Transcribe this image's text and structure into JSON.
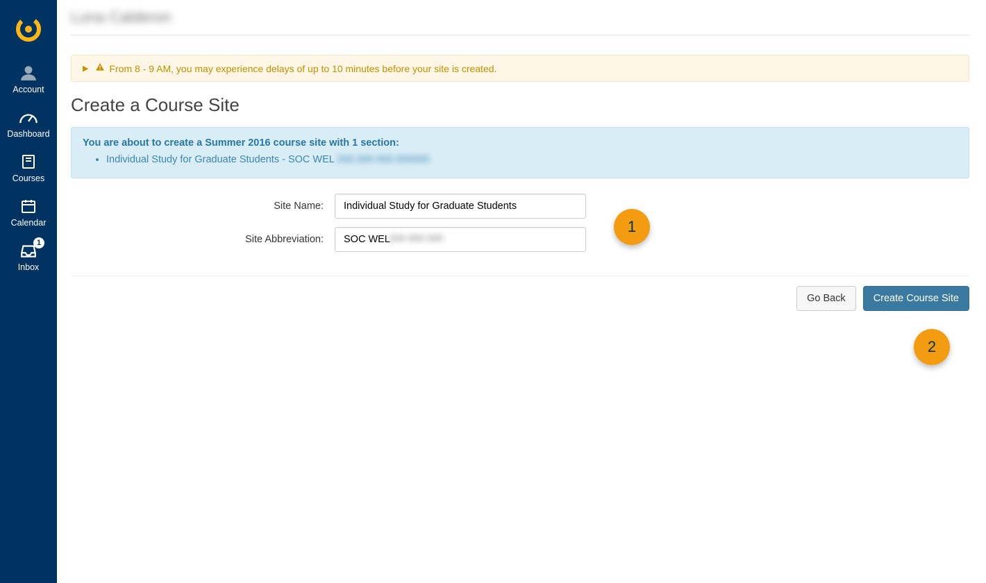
{
  "sidebar": {
    "items": [
      {
        "label": "Account"
      },
      {
        "label": "Dashboard"
      },
      {
        "label": "Courses"
      },
      {
        "label": "Calendar"
      },
      {
        "label": "Inbox",
        "badge": "1"
      }
    ]
  },
  "topbar": {
    "user_name_blurred": "Luna Calderon"
  },
  "alert": {
    "text": "From 8 - 9 AM, you may experience delays of up to 10 minutes before your site is created."
  },
  "page": {
    "title": "Create a Course Site"
  },
  "info": {
    "headline": "You are about to create a Summer 2016 course site with 1 section:",
    "item_prefix": "Individual Study for Graduate Students - SOC WEL",
    "item_redacted_tail": "200 000 000 000000"
  },
  "form": {
    "site_name_label": "Site Name:",
    "site_name_value": "Individual Study for Graduate Students",
    "site_abbrev_label": "Site Abbreviation:",
    "site_abbrev_value": "SOC WEL",
    "site_abbrev_redacted_tail": "200  000 000"
  },
  "markers": {
    "one": "1",
    "two": "2"
  },
  "actions": {
    "back": "Go Back",
    "create": "Create Course Site"
  },
  "colors": {
    "brand_navy": "#003262",
    "accent_orange": "#f39c12",
    "info_bg": "#d9edf7",
    "warn_bg": "#fdf6e6",
    "primary_btn": "#3a7aa1"
  }
}
